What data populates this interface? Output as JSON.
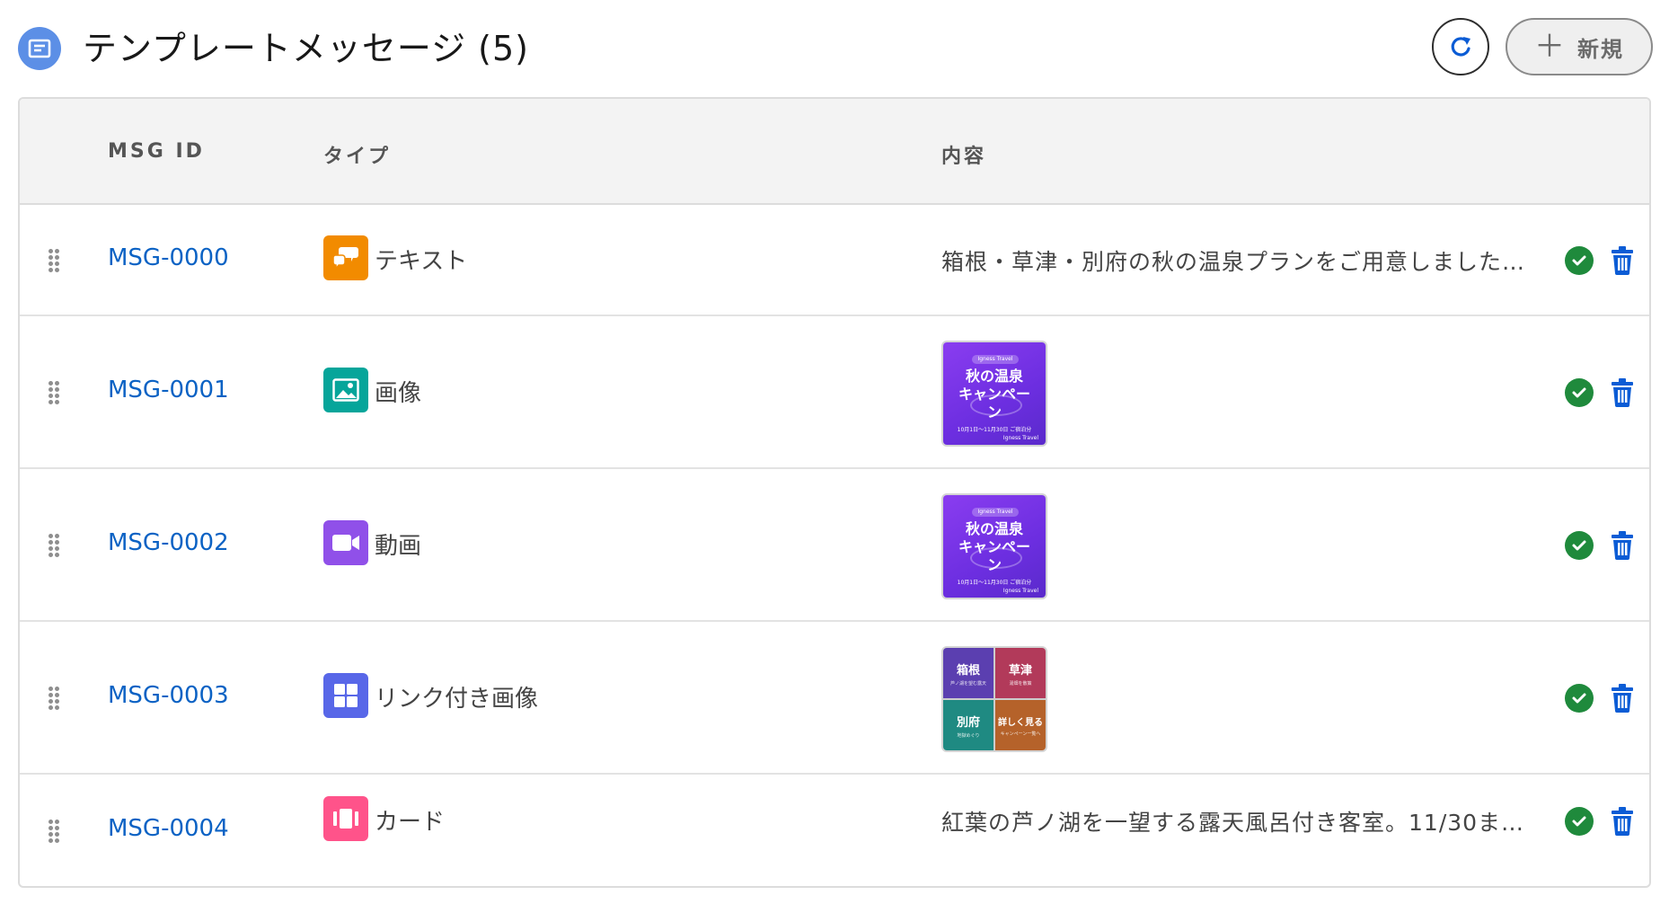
{
  "header": {
    "title": "テンプレートメッセージ (5)",
    "icon": "template-list-icon",
    "refresh_icon": "refresh-icon",
    "new_label": "新規",
    "new_icon": "plus-icon"
  },
  "table": {
    "columns": {
      "id": "MSG ID",
      "type": "タイプ",
      "content": "内容"
    },
    "rows": [
      {
        "id": "MSG-0000",
        "type": "テキスト",
        "type_icon": "chat-bubble-icon",
        "type_color": "#f28b00",
        "content_kind": "text",
        "content": "箱根・草津・別府の秋の温泉プランをご用意しました…",
        "status": "active"
      },
      {
        "id": "MSG-0001",
        "type": "画像",
        "type_icon": "image-icon",
        "type_color": "#06a59a",
        "content_kind": "campaign-image",
        "status": "active"
      },
      {
        "id": "MSG-0002",
        "type": "動画",
        "type_icon": "video-icon",
        "type_color": "#9050e9",
        "content_kind": "campaign-image",
        "status": "active"
      },
      {
        "id": "MSG-0003",
        "type": "リンク付き画像",
        "type_icon": "grid-icon",
        "type_color": "#5867e8",
        "content_kind": "image-grid",
        "status": "active"
      },
      {
        "id": "MSG-0004",
        "type": "カード",
        "type_icon": "carousel-card-icon",
        "type_color": "#ff538a",
        "content_kind": "text",
        "content": "紅葉の芦ノ湖を一望する露天風呂付き客室。11/30ま…",
        "status": "active"
      }
    ]
  },
  "campaign_thumb": {
    "brand": "Igness Travel",
    "headline_1": "秋の温泉",
    "headline_2": "キャンペー",
    "headline_3": "ン",
    "period": "10月1日〜11月30日 ご宿泊分",
    "footer": "Igness Travel"
  },
  "grid_thumb": {
    "cells": [
      {
        "title": "箱根",
        "sub": "芦ノ湖を望む露天",
        "color": "#5b3fb0"
      },
      {
        "title": "草津",
        "sub": "湯畑を散策",
        "color": "#b23a5a"
      },
      {
        "title": "別府",
        "sub": "地獄めぐり",
        "color": "#1f8a82"
      },
      {
        "title": "詳しく見る",
        "sub": "キャンペーン一覧へ",
        "color": "#b5622a"
      }
    ]
  },
  "colors": {
    "accent": "#0b62c4",
    "success": "#1f8a3c",
    "danger_icon": "#0b5cd5",
    "header_icon_bg": "#5c8fe6"
  }
}
